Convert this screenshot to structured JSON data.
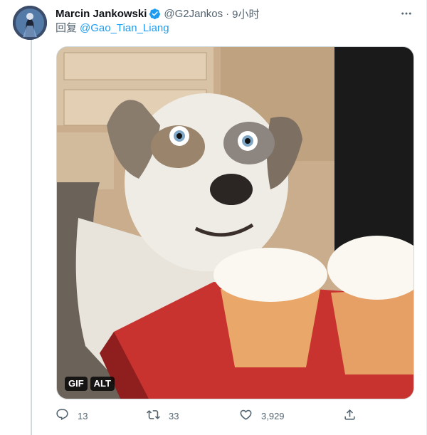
{
  "tweet": {
    "display_name": "Marcin Jankowski",
    "handle": "@G2Jankos",
    "separator": "·",
    "time": "9小时",
    "reply_prefix": "回复",
    "reply_to": "@Gao_Tian_Liang",
    "media_badges": {
      "gif": "GIF",
      "alt": "ALT"
    },
    "stats": {
      "replies": "13",
      "retweets": "33",
      "likes": "3,929"
    }
  },
  "colors": {
    "accent": "#1d9bf0",
    "muted": "#536471",
    "text": "#0f1419"
  },
  "icons": [
    "verified-badge-icon",
    "more-icon",
    "reply-icon",
    "retweet-icon",
    "like-icon",
    "share-icon"
  ]
}
